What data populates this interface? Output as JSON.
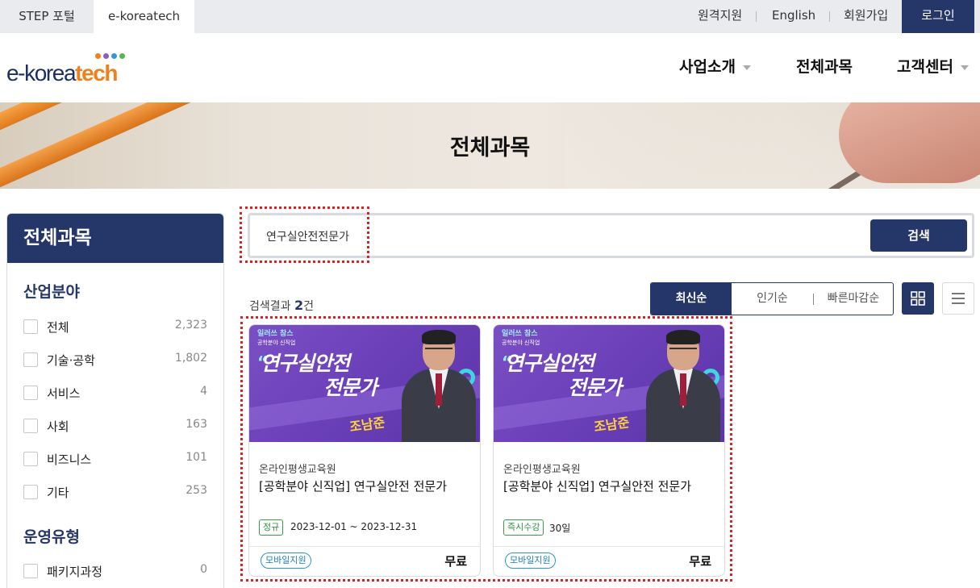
{
  "topbar": {
    "tabs": [
      {
        "label": "STEP 포털"
      },
      {
        "label": "e-koreatech"
      }
    ],
    "links": [
      {
        "label": "원격지원"
      },
      {
        "label": "English"
      },
      {
        "label": "회원가입"
      }
    ],
    "login_label": "로그인"
  },
  "header": {
    "logo_text_dark": "e-korea",
    "logo_text_accent": "tech",
    "logo_dot_colors": [
      "#f07f1c",
      "#8e5cc4",
      "#2e9ad6",
      "#56b84a"
    ],
    "nav": [
      {
        "label": "사업소개"
      },
      {
        "label": "전체과목"
      },
      {
        "label": "고객센터"
      }
    ]
  },
  "hero": {
    "title": "전체과목"
  },
  "sidebar": {
    "title": "전체과목",
    "industry_title": "산업분야",
    "industry_items": [
      {
        "label": "전체",
        "count": "2,323"
      },
      {
        "label": "기술·공학",
        "count": "1,802"
      },
      {
        "label": "서비스",
        "count": "4"
      },
      {
        "label": "사회",
        "count": "163"
      },
      {
        "label": "비즈니스",
        "count": "101"
      },
      {
        "label": "기타",
        "count": "253"
      }
    ],
    "operation_title": "운영유형",
    "operation_items": [
      {
        "label": "패키지과정",
        "count": "0"
      }
    ]
  },
  "search": {
    "value": "연구실안전전문가",
    "button_label": "검색"
  },
  "results": {
    "label": "검색결과",
    "count": "2",
    "unit": "건",
    "sort_options": [
      {
        "label": "최신순"
      },
      {
        "label": "인기순"
      },
      {
        "label": "빠른마감순"
      }
    ]
  },
  "courses": [
    {
      "thumb_brand": "일러쓰 참스",
      "thumb_sub": "공학분야 신직업",
      "thumb_line1": "연구실안전",
      "thumb_line2": "전문가",
      "thumb_name": "조남준",
      "org": "온라인평생교육원",
      "title": "[공학분야 신직업] 연구실안전 전문가",
      "badge": "정규",
      "period": "2023-12-01 ~ 2023-12-31",
      "mobile": "모바일지원",
      "price": "무료"
    },
    {
      "thumb_brand": "일러쓰 참스",
      "thumb_sub": "공학분야 신직업",
      "thumb_line1": "연구실안전",
      "thumb_line2": "전문가",
      "thumb_name": "조남준",
      "org": "온라인평생교육원",
      "title": "[공학분야 신직업] 연구실안전 전문가",
      "badge": "즉시수강",
      "period": "30일",
      "mobile": "모바일지원",
      "price": "무료"
    }
  ]
}
